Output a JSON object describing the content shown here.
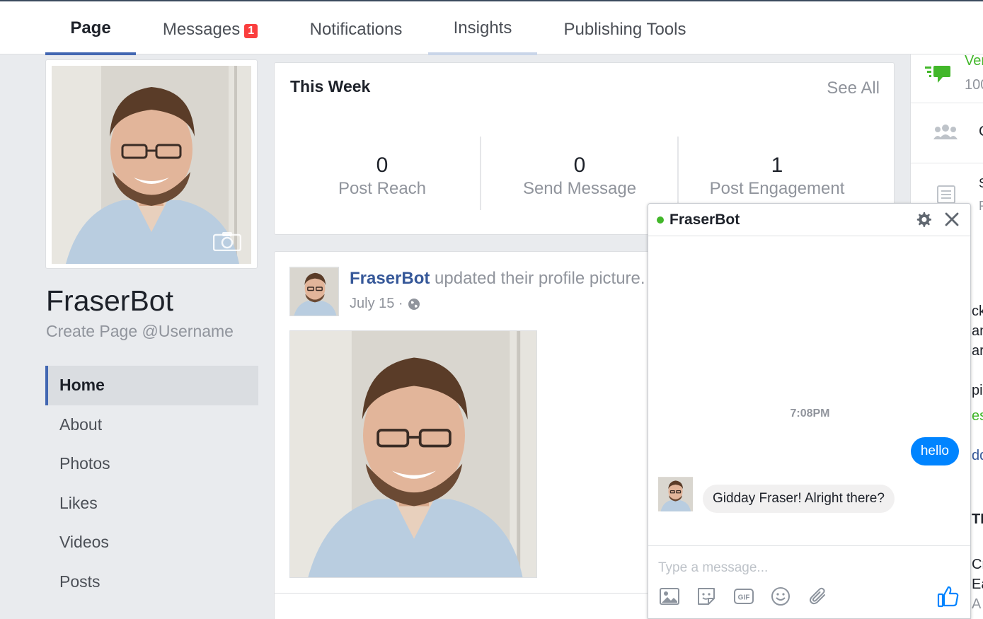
{
  "tabs": [
    {
      "label": "Page"
    },
    {
      "label": "Messages",
      "badge": "1"
    },
    {
      "label": "Notifications"
    },
    {
      "label": "Insights"
    },
    {
      "label": "Publishing Tools"
    }
  ],
  "profile": {
    "name": "FraserBot",
    "username_link": "Create Page @Username"
  },
  "leftnav": [
    {
      "label": "Home"
    },
    {
      "label": "About"
    },
    {
      "label": "Photos"
    },
    {
      "label": "Likes"
    },
    {
      "label": "Videos"
    },
    {
      "label": "Posts"
    }
  ],
  "week": {
    "title": "This Week",
    "see_all": "See All",
    "stats": [
      {
        "value": "0",
        "label": "Post Reach"
      },
      {
        "value": "0",
        "label": "Send Message"
      },
      {
        "value": "1",
        "label": "Post Engagement"
      }
    ]
  },
  "post": {
    "author": "FraserBot",
    "action": " updated their profile picture.",
    "date": "July 15 ·"
  },
  "right": {
    "line1": "Ver",
    "line2": "100",
    "frag_c": "C",
    "frag_s": "S",
    "frag_f": "F",
    "frag_ck": "ck",
    "frag_an": "an",
    "frag_ar": "ar",
    "frag_pi": "pi",
    "frag_es": "es",
    "frag_dd": "dd",
    "frag_ti": "TI",
    "frag_cr": "Cr",
    "frag_ea": "Ea",
    "frag_a": "A"
  },
  "chat": {
    "title": "FraserBot",
    "time": "7:08PM",
    "outgoing": "hello",
    "incoming": "Gidday Fraser! Alright there?",
    "placeholder": "Type a message..."
  },
  "colors": {
    "accent": "#4267b2",
    "link": "#365899",
    "messenger_blue": "#0084ff",
    "online": "#42b72a",
    "badge": "#fa3e3e"
  }
}
